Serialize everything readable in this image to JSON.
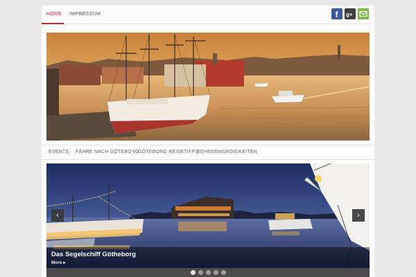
{
  "topnav": {
    "items": [
      {
        "label": "HOME",
        "active": true
      },
      {
        "label": "IMPRESSUM",
        "active": false
      }
    ],
    "social": [
      {
        "name": "facebook",
        "icon": "facebook-icon",
        "glyph": "f",
        "color": "#3b5998"
      },
      {
        "name": "google-plus",
        "icon": "google-plus-icon",
        "glyph": "g+",
        "color": "#3d3d3d"
      },
      {
        "name": "email",
        "icon": "mail-icon",
        "glyph": "mail",
        "color": "#7ab648"
      }
    ]
  },
  "accent_color": "#d2262b",
  "catnav": {
    "items": [
      "EVENTS",
      "FÄHRE NACH GÖTEBORG",
      "GÖTEBORG REISETIPPS",
      "SEHENSWÜRDIGKEITEN"
    ]
  },
  "slider": {
    "prev_icon": "chevron-left-icon",
    "next_icon": "chevron-right-icon",
    "prev_glyph": "‹",
    "next_glyph": "›",
    "caption_title": "Das Segelschiff Götheborg",
    "caption_more": "More ▸",
    "slide_count": 5,
    "active_slide": 1
  }
}
